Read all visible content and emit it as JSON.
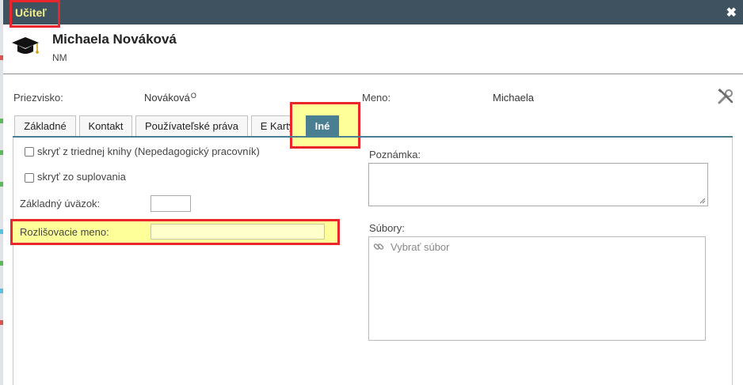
{
  "window": {
    "title": "Učiteľ"
  },
  "person": {
    "name": "Michaela Nováková",
    "abbr": "NM"
  },
  "fields": {
    "surname_label": "Priezvisko:",
    "surname_value": "Nováková",
    "surname_mark": "O",
    "firstname_label": "Meno:",
    "firstname_value": "Michaela"
  },
  "tabs": [
    {
      "label": "Základné"
    },
    {
      "label": "Kontakt"
    },
    {
      "label": "Používateľské práva"
    },
    {
      "label": "E Karty"
    },
    {
      "label": "Iné",
      "active": true
    }
  ],
  "form": {
    "hide_class_book": "skryť z triednej knihy (Nepedagogický pracovník)",
    "hide_substitution": "skryť zo suplovania",
    "workload_label": "Základný úväzok:",
    "workload_value": "",
    "dist_name_label": "Rozlišovacie meno:",
    "dist_name_value": "",
    "note_label": "Poznámka:",
    "note_value": "",
    "files_label": "Súbory:",
    "files_placeholder": "Vybrať súbor"
  },
  "icons": {
    "close": "close-icon",
    "cap": "graduation-cap-icon",
    "tools": "tools-icon",
    "link": "link-icon"
  },
  "colors": {
    "titlebar": "#3f5260",
    "title_text": "#f2ef8a",
    "active_tab": "#4a7f92",
    "highlight_border": "#e8262b",
    "highlight_fill": "#ffff99",
    "input_yellow": "#ffffcc"
  }
}
